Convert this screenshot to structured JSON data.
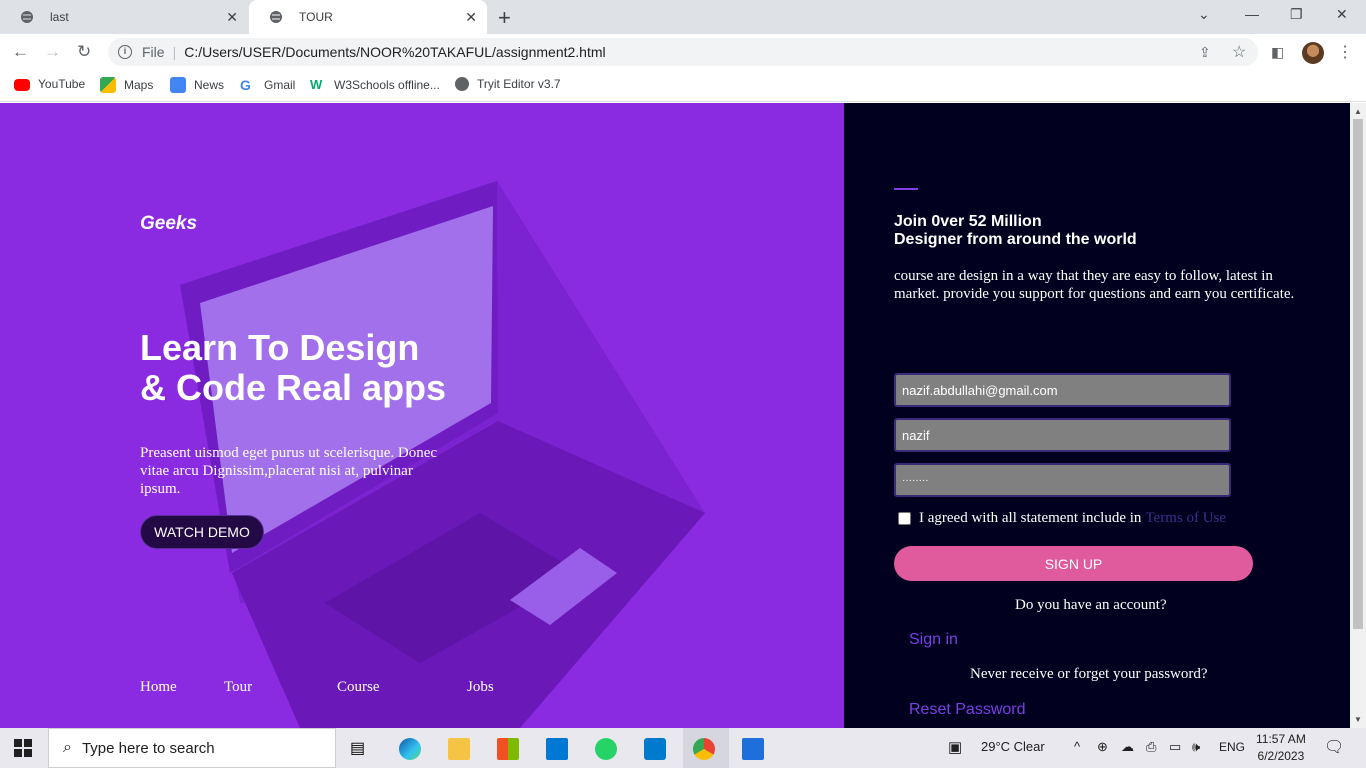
{
  "browser": {
    "tabs": [
      {
        "title": "last"
      },
      {
        "title": "TOUR"
      }
    ],
    "new_tab_label": "+",
    "address": {
      "scheme_label": "File",
      "url": "C:/Users/USER/Documents/NOOR%20TAKAFUL/assignment2.html"
    },
    "bookmarks": [
      {
        "label": "YouTube",
        "icon": "youtube-icon"
      },
      {
        "label": "Maps",
        "icon": "maps-icon"
      },
      {
        "label": "News",
        "icon": "news-icon"
      },
      {
        "label": "Gmail",
        "icon": "google-icon"
      },
      {
        "label": "W3Schools offline...",
        "icon": "w3schools-icon"
      },
      {
        "label": "Tryit Editor v3.7",
        "icon": "globe-icon"
      }
    ]
  },
  "hero": {
    "logo": "Geeks",
    "headline_line1": "Learn To Design",
    "headline_line2": "& Code Real apps",
    "lead": "Preasent uismod eget purus ut scelerisque. Donec vitae arcu Dignissim,placerat nisi at, pulvinar ipsum.",
    "cta": "WATCH DEMO",
    "nav": [
      "Home",
      "Tour",
      "Course",
      "Jobs"
    ]
  },
  "signup": {
    "title_line1": "Join 0ver 52 Million",
    "title_line2": "Designer from around the world",
    "description": "course are design in a way that they are easy to follow, latest in market. provide you support for questions and earn you certificate.",
    "email_value": "nazif.abdullahi@gmail.com",
    "name_value": "nazif",
    "password_value": "········",
    "agree_text": "I agreed with all statement include in",
    "terms_link": "Terms of Use",
    "submit": "SIGN UP",
    "account_question": "Do you have an account?",
    "signin_link": "Sign in",
    "forgot_question": "Never receive or forget your password?",
    "reset_link": "Reset Password"
  },
  "taskbar": {
    "search_placeholder": "Type here to search",
    "weather": "29°C  Clear",
    "language": "ENG",
    "time": "11:57 AM",
    "date": "6/2/2023"
  },
  "colors": {
    "left_panel": "#8a2be2",
    "right_panel": "#01001f",
    "signup_button": "#e05a9e",
    "link": "#7b3fe4"
  }
}
